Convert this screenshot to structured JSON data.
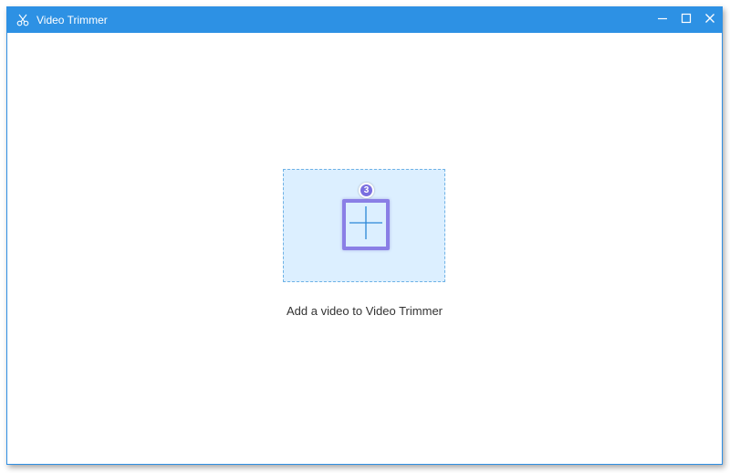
{
  "window": {
    "title": "Video Trimmer",
    "app_icon": "scissors-icon",
    "controls": [
      "minimize-icon",
      "maximize-icon",
      "close-icon"
    ]
  },
  "main": {
    "add_button_icon": "plus-icon",
    "step_badge": "3",
    "hint": "Add a video to Video Trimmer"
  },
  "colors": {
    "titlebar": "#2d91e4",
    "drop_zone_bg": "#dcefff",
    "drop_zone_border": "#6fb2e6",
    "highlight": "#8a7fe6",
    "plus": "#2b86d6"
  }
}
